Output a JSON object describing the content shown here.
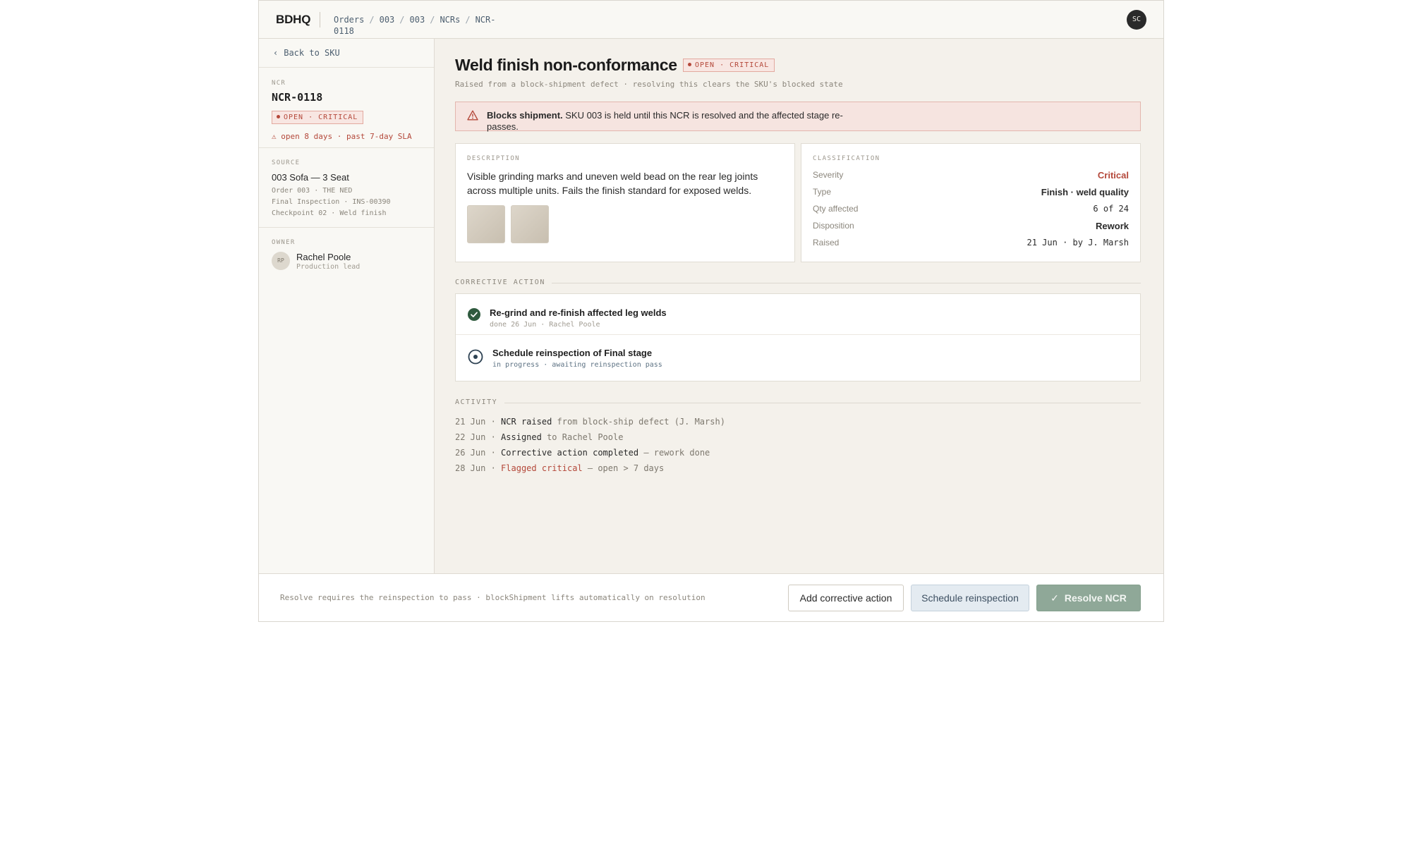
{
  "header": {
    "brand": "BDHQ",
    "breadcrumb": [
      "Orders",
      "003",
      "003",
      "NCRs",
      "NCR-0118"
    ],
    "user_initials": "SC"
  },
  "sidebar": {
    "back_label": "Back to SKU",
    "ncr_label": "NCR",
    "ncr_id": "NCR-0118",
    "status_badge": "OPEN · CRITICAL",
    "sla_warning": "⚠ open 8 days · past 7-day SLA",
    "source_label": "SOURCE",
    "source_title": "003 Sofa — 3 Seat",
    "source_lines": [
      "Order 003 · THE NED",
      "Final Inspection · INS-00390",
      "Checkpoint 02 · Weld finish"
    ],
    "owner_label": "OWNER",
    "owner_initials": "RP",
    "owner_name": "Rachel Poole",
    "owner_role": "Production lead"
  },
  "main": {
    "title": "Weld finish non-conformance",
    "status_badge": "OPEN · CRITICAL",
    "subtitle": "Raised from a block-shipment defect · resolving this clears the SKU's blocked state",
    "alert": {
      "bold": "Blocks shipment.",
      "text": "SKU 003 is held until this NCR is resolved and the affected stage re-passes."
    },
    "description": {
      "label": "DESCRIPTION",
      "text": "Visible grinding marks and uneven weld bead on the rear leg joints across multiple units. Fails the finish standard for exposed welds."
    },
    "classification": {
      "label": "CLASSIFICATION",
      "rows": [
        {
          "key": "Severity",
          "value": "Critical"
        },
        {
          "key": "Type",
          "value": "Finish · weld quality"
        },
        {
          "key": "Qty affected",
          "value": "6 of 24"
        },
        {
          "key": "Disposition",
          "value": "Rework"
        },
        {
          "key": "Raised",
          "value": "21 Jun · by J. Marsh"
        }
      ]
    },
    "corrective_label": "CORRECTIVE ACTION",
    "actions": [
      {
        "title": "Re-grind and re-finish affected leg welds",
        "sub": "done 26 Jun · Rachel Poole",
        "status": "done"
      },
      {
        "title": "Schedule reinspection of Final stage",
        "sub": "in progress · awaiting reinspection pass",
        "status": "in-progress"
      }
    ],
    "activity_label": "ACTIVITY",
    "activity": [
      {
        "date": "21 Jun",
        "strong": "NCR raised",
        "rest": " from block-ship defect (J. Marsh)",
        "red": false
      },
      {
        "date": "22 Jun",
        "strong": "Assigned",
        "rest": " to Rachel Poole",
        "red": false
      },
      {
        "date": "26 Jun",
        "strong": "Corrective action completed",
        "rest": " — rework done",
        "red": false
      },
      {
        "date": "28 Jun",
        "strong": "Flagged critical",
        "rest": " — open > 7 days",
        "red": true
      }
    ]
  },
  "footer": {
    "note": "Resolve requires the reinspection to pass · blockShipment lifts automatically on resolution",
    "add_action": "Add corrective action",
    "schedule": "Schedule reinspection",
    "resolve": "Resolve NCR"
  },
  "colors": {
    "critical": "#b4483a",
    "done_green": "#2f5a3e",
    "link_blue": "#4d5f70",
    "resolve_bg": "#8fa898"
  }
}
